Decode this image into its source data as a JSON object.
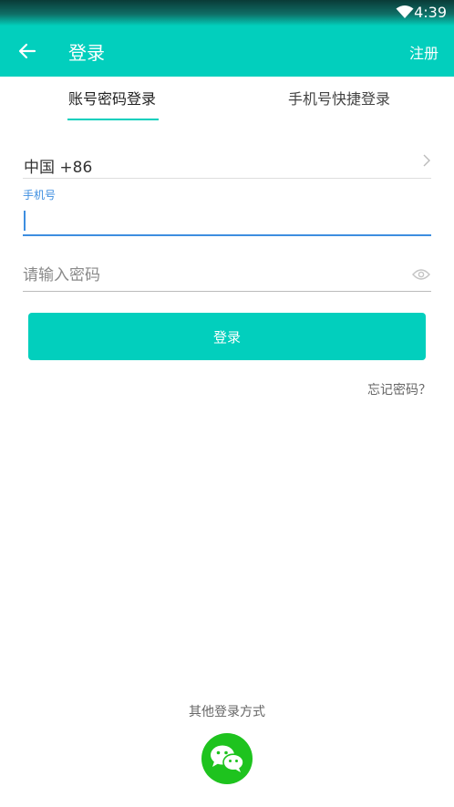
{
  "status_bar": {
    "time": "4:39"
  },
  "app_bar": {
    "title": "登录",
    "register_label": "注册"
  },
  "tabs": [
    {
      "label": "账号密码登录",
      "active": true
    },
    {
      "label": "手机号快捷登录",
      "active": false
    }
  ],
  "form": {
    "country_code": "中国 +86",
    "phone_label": "手机号",
    "phone_value": "",
    "password_placeholder": "请输入密码",
    "login_label": "登录",
    "forgot_label": "忘记密码？"
  },
  "other_login": {
    "title": "其他登录方式",
    "icons": [
      "wechat-icon"
    ]
  },
  "colors": {
    "accent": "#02cfbd",
    "focus": "#3d8ee0",
    "wechat": "#1ec31e"
  }
}
